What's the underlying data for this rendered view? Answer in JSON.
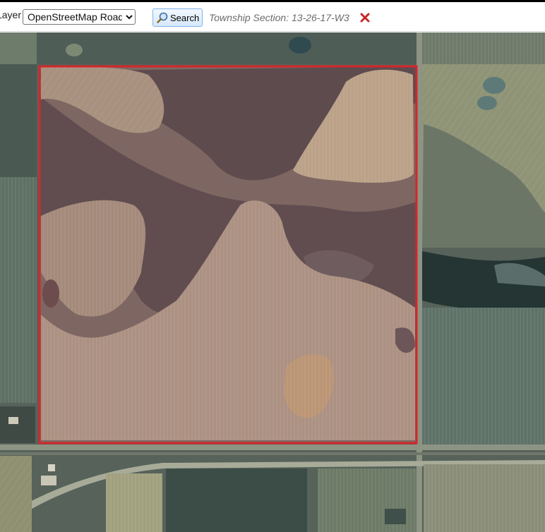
{
  "toolbar": {
    "layer_label": "Layer:",
    "layer_options": [
      "OpenStreetMap Roads"
    ],
    "layer_selected": "OpenStreetMap Roads",
    "search_label": "Search",
    "township_section": "Township Section: 13-26-17-W3"
  },
  "colors": {
    "selection_outline": "#d4262b",
    "close_icon": "#c62828",
    "search_button_border": "#7eb4ea"
  },
  "icons": {
    "search": "magnifier-icon",
    "clear": "close-icon",
    "dropdown": "chevron-down-icon"
  }
}
